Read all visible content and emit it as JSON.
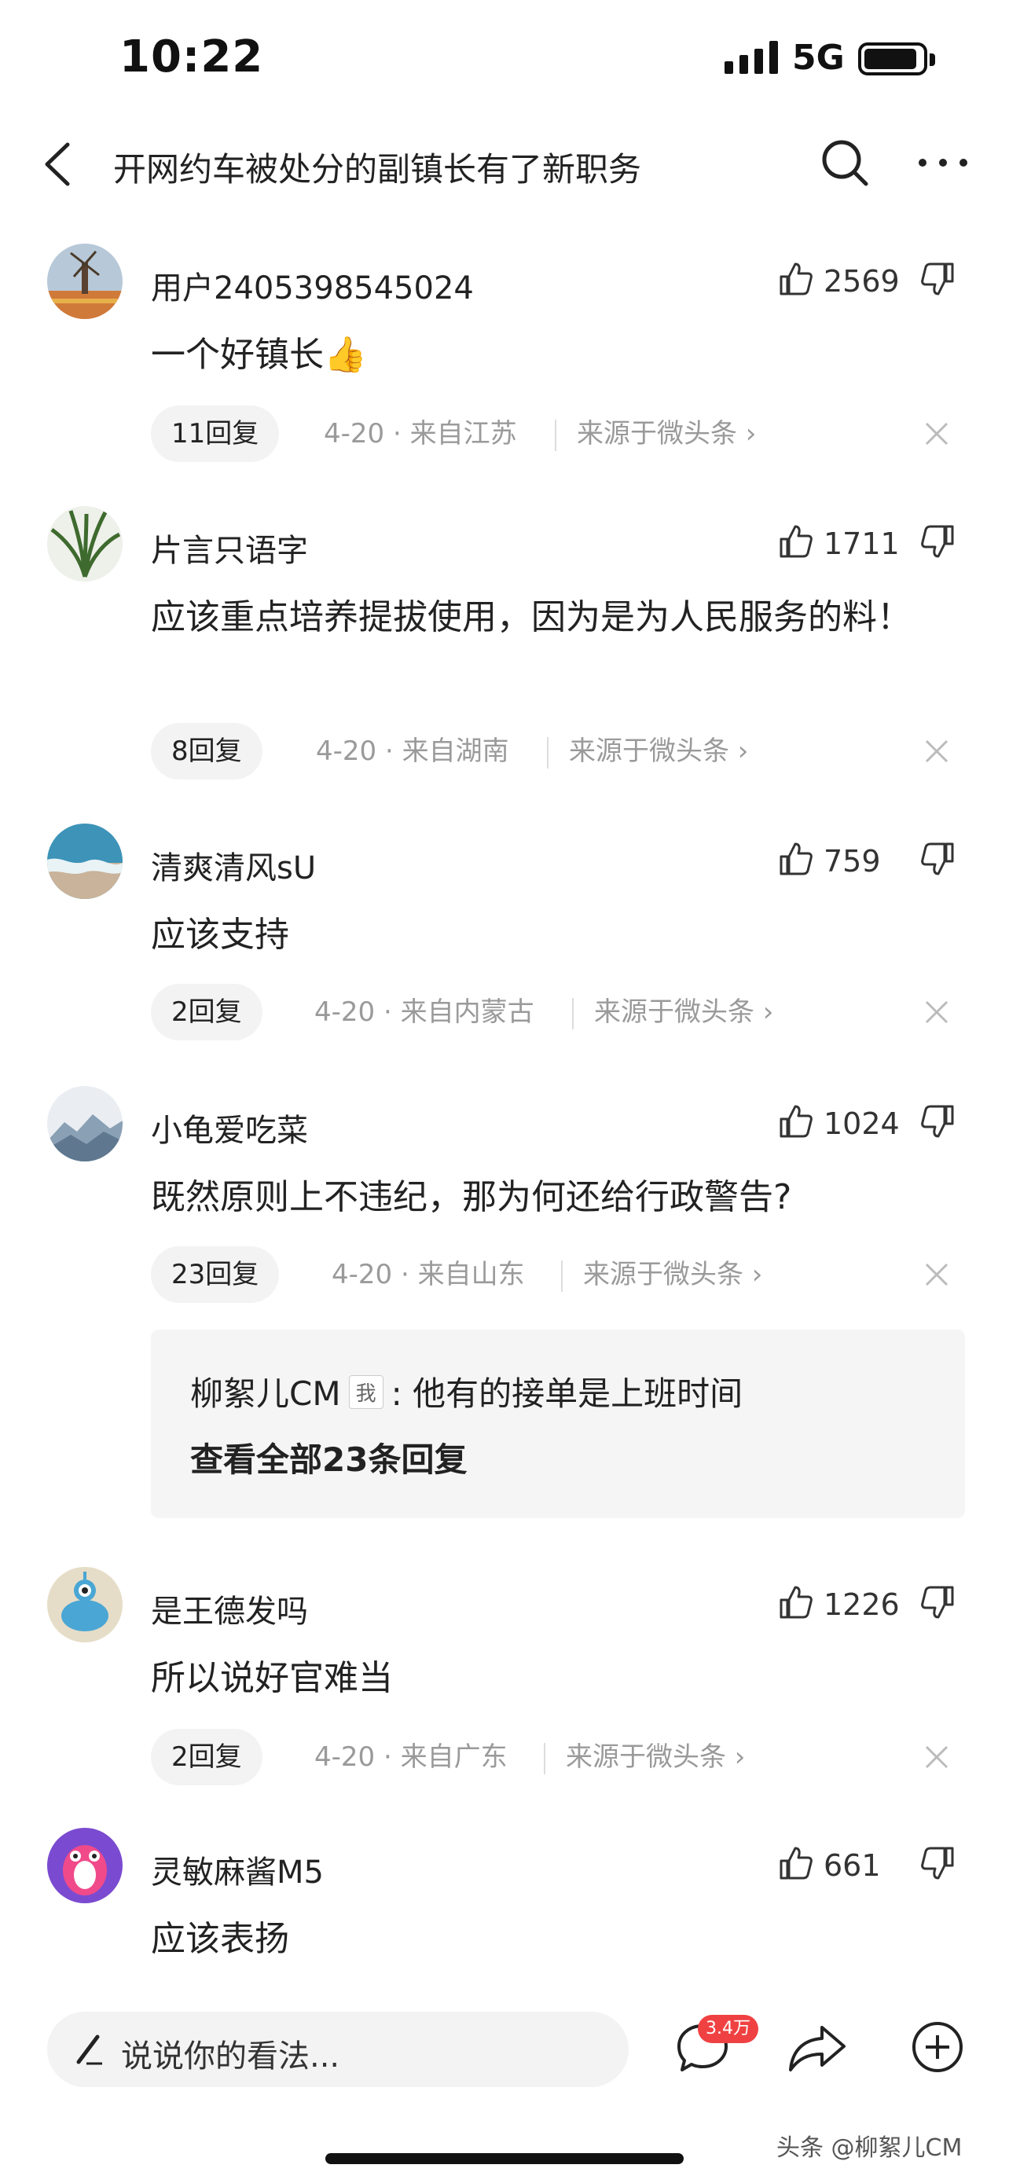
{
  "status_bar": {
    "time": "10:22",
    "network": "5G"
  },
  "nav": {
    "title": "开网约车被处分的副镇长有了新职务"
  },
  "comments": [
    {
      "username": "用户2405398545024",
      "likes": "2569",
      "text": "一个好镇长👍",
      "replies": "11回复",
      "date_location": "4-20 · 来自江苏",
      "source": "来源于微头条 ›"
    },
    {
      "username": "片言只语字",
      "likes": "1711",
      "text": "应该重点培养提拔使用，因为是为人民服务的料！",
      "replies": "8回复",
      "date_location": "4-20 · 来自湖南",
      "source": "来源于微头条 ›"
    },
    {
      "username": "清爽清风sU",
      "likes": "759",
      "text": "应该支持",
      "replies": "2回复",
      "date_location": "4-20 · 来自内蒙古",
      "source": "来源于微头条 ›"
    },
    {
      "username": "小龟爱吃菜",
      "likes": "1024",
      "text": "既然原则上不违纪，那为何还给行政警告?",
      "replies": "23回复",
      "date_location": "4-20 · 来自山东",
      "source": "来源于微头条 ›",
      "reply_preview": {
        "author": "柳絮儿CM",
        "tag": "我",
        "text": ": 他有的接单是上班时间",
        "view_all": "查看全部23条回复"
      }
    },
    {
      "username": "是王德发吗",
      "likes": "1226",
      "text": "所以说好官难当",
      "replies": "2回复",
      "date_location": "4-20 · 来自广东",
      "source": "来源于微头条 ›"
    },
    {
      "username": "灵敏麻酱M5",
      "likes": "661",
      "text": "应该表扬"
    }
  ],
  "bottom_bar": {
    "placeholder": "说说你的看法...",
    "comment_count": "3.4万"
  },
  "watermark": "头条 @柳絮儿CM",
  "colors": {
    "badge": "#f04142",
    "meta": "#9a9a9a",
    "pill_bg": "#f3f3f3"
  }
}
